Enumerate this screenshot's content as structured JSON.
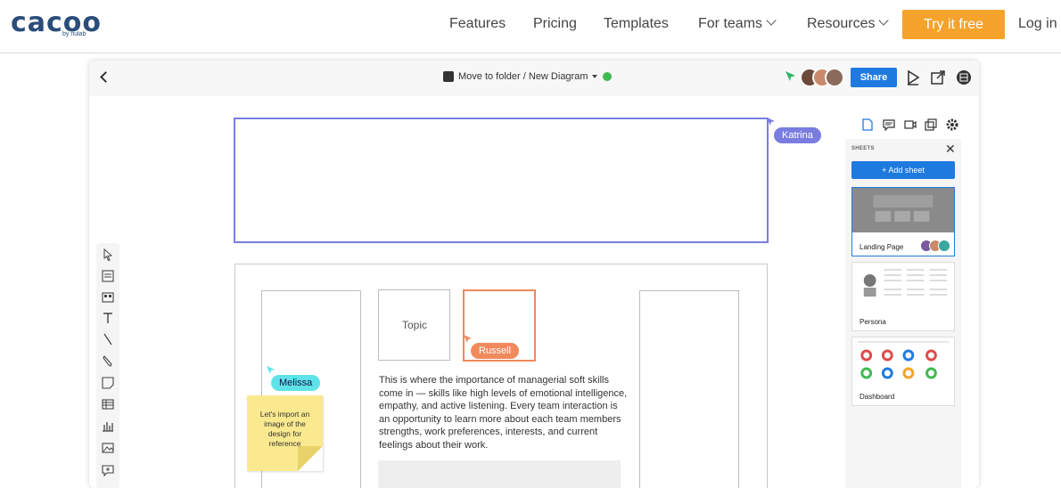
{
  "site": {
    "logo_text": "cacoo",
    "logo_sub": "by nulab",
    "nav": [
      {
        "label": "Features"
      },
      {
        "label": "Pricing"
      },
      {
        "label": "Templates"
      },
      {
        "label": "For teams"
      },
      {
        "label": "Resources"
      }
    ],
    "cta_label": "Try it free",
    "login_label": "Log in",
    "cta_color": "#f5a32a"
  },
  "editor": {
    "breadcrumb": "Move to folder / New Diagram",
    "share_label": "Share",
    "accent_color": "#1f7ae0"
  },
  "canvas": {
    "collaborators": [
      {
        "name": "Katrina",
        "color": "#7a7de0"
      },
      {
        "name": "Russell",
        "color": "#f08a5d"
      },
      {
        "name": "Melissa",
        "color": "#5fe3e8"
      }
    ],
    "topic_label": "Topic",
    "body_text": "This is where the importance of managerial soft skills come in — skills like high levels of emotional intelligence, empathy, and active listening. Every team interaction is an opportunity to learn more about each team members strengths, work preferences, interests, and current feelings about their work.",
    "sticky_note": "Let's import an image of the design for reference"
  },
  "toolbar": {
    "tools": [
      "pointer-icon",
      "template-icon",
      "shapes-icon",
      "text-icon",
      "line-icon",
      "pen-icon",
      "sticky-note-icon",
      "table-icon",
      "chart-icon",
      "image-icon",
      "comment-icon"
    ]
  },
  "sheets": {
    "title": "SHEETS",
    "add_label": "+ Add sheet",
    "items": [
      {
        "label": "Landing Page"
      },
      {
        "label": "Persona"
      },
      {
        "label": "Dashboard"
      }
    ]
  }
}
